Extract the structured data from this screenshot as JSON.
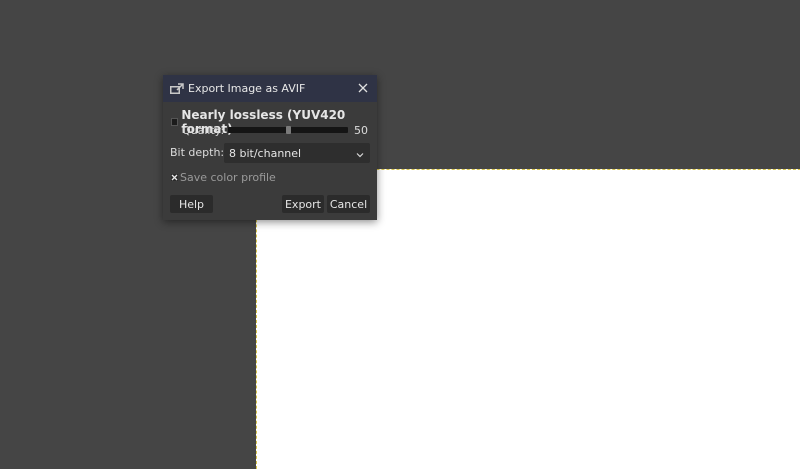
{
  "dialog": {
    "title": "Export Image as AVIF",
    "nearly_lossless_label": "Nearly lossless (YUV420 format)",
    "nearly_lossless_checked": false,
    "quality_label": "Quality:",
    "quality_value": "50",
    "quality_fraction": 0.5,
    "bit_depth_label": "Bit depth:",
    "bit_depth_value": "8 bit/channel",
    "save_color_profile_label": "Save color profile",
    "save_color_profile_checked": true,
    "buttons": {
      "help": "Help",
      "export": "Export",
      "cancel": "Cancel"
    }
  },
  "icons": {
    "title": "export-image-icon",
    "close": "close-icon",
    "dropdown": "chevron-down-icon",
    "checkmark": "check-icon"
  },
  "colors": {
    "workspace": "#454545",
    "canvas": "#ffffff",
    "dialog_bg": "#3b3b3b",
    "titlebar_bg": "#2f3345",
    "selection_border": "#d6c34a"
  }
}
